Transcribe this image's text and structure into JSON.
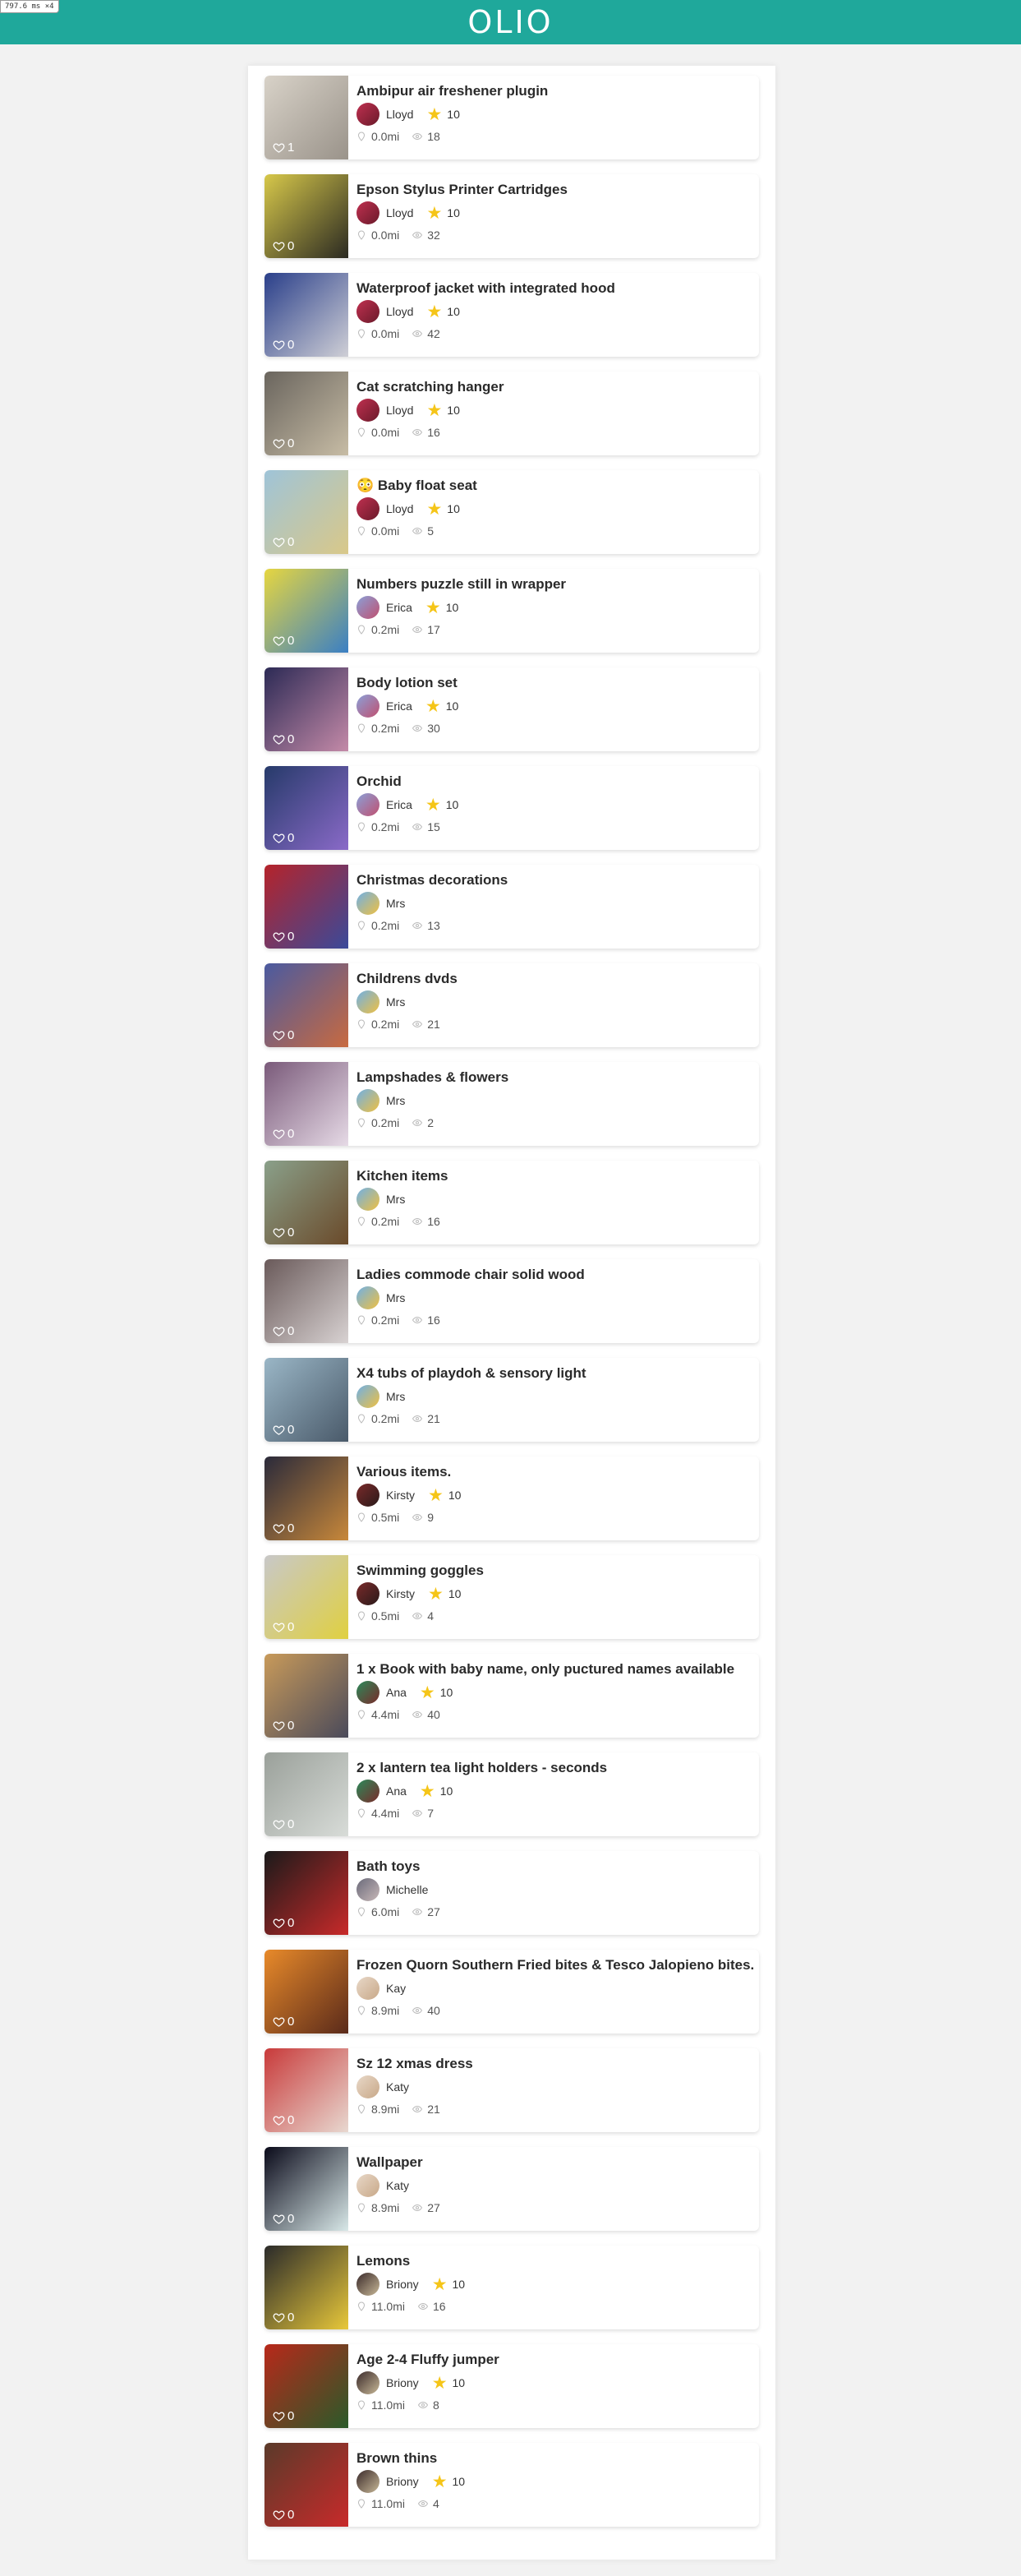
{
  "debug": "797.6 ms ×4",
  "app": {
    "logo": "OLIO"
  },
  "listings": [
    {
      "title": "Ambipur air freshener plugin",
      "user": "Lloyd",
      "rating": "10",
      "distance": "0.0mi",
      "views": "18",
      "likes": "1",
      "thumb": [
        "#d8d2c8",
        "#9a938a"
      ],
      "avatar": [
        "#c03050",
        "#6a1a2a"
      ]
    },
    {
      "title": "Epson Stylus Printer Cartridges",
      "user": "Lloyd",
      "rating": "10",
      "distance": "0.0mi",
      "views": "32",
      "likes": "0",
      "thumb": [
        "#d7c84a",
        "#2b2a22"
      ],
      "avatar": [
        "#c03050",
        "#6a1a2a"
      ]
    },
    {
      "title": "Waterproof jacket with integrated hood",
      "user": "Lloyd",
      "rating": "10",
      "distance": "0.0mi",
      "views": "42",
      "likes": "0",
      "thumb": [
        "#2a3f8a",
        "#cfcfd6"
      ],
      "avatar": [
        "#c03050",
        "#6a1a2a"
      ]
    },
    {
      "title": "Cat scratching hanger",
      "user": "Lloyd",
      "rating": "10",
      "distance": "0.0mi",
      "views": "16",
      "likes": "0",
      "thumb": [
        "#6a655e",
        "#c7bca5"
      ],
      "avatar": [
        "#c03050",
        "#6a1a2a"
      ]
    },
    {
      "title": "😳 Baby float seat",
      "user": "Lloyd",
      "rating": "10",
      "distance": "0.0mi",
      "views": "5",
      "likes": "0",
      "thumb": [
        "#9fc4d8",
        "#d9c889"
      ],
      "avatar": [
        "#c03050",
        "#6a1a2a"
      ]
    },
    {
      "title": "Numbers puzzle still in wrapper",
      "user": "Erica",
      "rating": "10",
      "distance": "0.2mi",
      "views": "17",
      "likes": "0",
      "thumb": [
        "#e6d640",
        "#3a7fc4"
      ],
      "avatar": [
        "#8aa0d8",
        "#c05070"
      ]
    },
    {
      "title": "Body lotion set",
      "user": "Erica",
      "rating": "10",
      "distance": "0.2mi",
      "views": "30",
      "likes": "0",
      "thumb": [
        "#2c2a55",
        "#c48aa8"
      ],
      "avatar": [
        "#8aa0d8",
        "#c05070"
      ]
    },
    {
      "title": "Orchid",
      "user": "Erica",
      "rating": "10",
      "distance": "0.2mi",
      "views": "15",
      "likes": "0",
      "thumb": [
        "#263a6a",
        "#8a6ac8"
      ],
      "avatar": [
        "#8aa0d8",
        "#c05070"
      ]
    },
    {
      "title": "Christmas decorations",
      "user": "Mrs",
      "rating": "",
      "distance": "0.2mi",
      "views": "13",
      "likes": "0",
      "thumb": [
        "#b5232a",
        "#3a4a9a"
      ],
      "avatar": [
        "#6fb0e6",
        "#f0c040"
      ]
    },
    {
      "title": "Childrens dvds",
      "user": "Mrs",
      "rating": "",
      "distance": "0.2mi",
      "views": "21",
      "likes": "0",
      "thumb": [
        "#4a5aa0",
        "#c86a40"
      ],
      "avatar": [
        "#6fb0e6",
        "#f0c040"
      ]
    },
    {
      "title": "Lampshades & flowers",
      "user": "Mrs",
      "rating": "",
      "distance": "0.2mi",
      "views": "2",
      "likes": "0",
      "thumb": [
        "#7a5a7a",
        "#e6dae6"
      ],
      "avatar": [
        "#6fb0e6",
        "#f0c040"
      ]
    },
    {
      "title": "Kitchen items",
      "user": "Mrs",
      "rating": "",
      "distance": "0.2mi",
      "views": "16",
      "likes": "0",
      "thumb": [
        "#8aa08a",
        "#6a4a2a"
      ],
      "avatar": [
        "#6fb0e6",
        "#f0c040"
      ]
    },
    {
      "title": "Ladies commode chair solid wood",
      "user": "Mrs",
      "rating": "",
      "distance": "0.2mi",
      "views": "16",
      "likes": "0",
      "thumb": [
        "#6a5a5a",
        "#d8d2d2"
      ],
      "avatar": [
        "#6fb0e6",
        "#f0c040"
      ]
    },
    {
      "title": "X4 tubs of playdoh & sensory light",
      "user": "Mrs",
      "rating": "",
      "distance": "0.2mi",
      "views": "21",
      "likes": "0",
      "thumb": [
        "#9ab6c6",
        "#4a5a6a"
      ],
      "avatar": [
        "#6fb0e6",
        "#f0c040"
      ]
    },
    {
      "title": "Various items.",
      "user": "Kirsty",
      "rating": "10",
      "distance": "0.5mi",
      "views": "9",
      "likes": "0",
      "thumb": [
        "#2a2a3a",
        "#c8883a"
      ],
      "avatar": [
        "#7a2a2a",
        "#2a1a1a"
      ]
    },
    {
      "title": "Swimming goggles",
      "user": "Kirsty",
      "rating": "10",
      "distance": "0.5mi",
      "views": "4",
      "likes": "0",
      "thumb": [
        "#c8c8c8",
        "#e0d040"
      ],
      "avatar": [
        "#7a2a2a",
        "#2a1a1a"
      ]
    },
    {
      "title": "1 x Book with baby name, only puctured names available",
      "user": "Ana",
      "rating": "10",
      "distance": "4.4mi",
      "views": "40",
      "likes": "0",
      "thumb": [
        "#c89a5a",
        "#4a4a5a"
      ],
      "avatar": [
        "#2a8a5a",
        "#7a2a2a"
      ]
    },
    {
      "title": "2 x lantern tea light holders - seconds",
      "user": "Ana",
      "rating": "10",
      "distance": "4.4mi",
      "views": "7",
      "likes": "0",
      "thumb": [
        "#9aa09a",
        "#d8dcd8"
      ],
      "avatar": [
        "#2a8a5a",
        "#7a2a2a"
      ]
    },
    {
      "title": "Bath toys",
      "user": "Michelle",
      "rating": "",
      "distance": "6.0mi",
      "views": "27",
      "likes": "0",
      "thumb": [
        "#1a1a1a",
        "#c82a2a"
      ],
      "avatar": [
        "#6a6a7a",
        "#c8b8b8"
      ]
    },
    {
      "title": "Frozen Quorn Southern Fried bites & Tesco Jalopieno bites.",
      "user": "Kay",
      "rating": "",
      "distance": "8.9mi",
      "views": "40",
      "likes": "0",
      "thumb": [
        "#e88a2a",
        "#5a2a1a"
      ],
      "avatar": [
        "#e8d8c8",
        "#c8a888"
      ]
    },
    {
      "title": "Sz 12 xmas dress",
      "user": "Katy",
      "rating": "",
      "distance": "8.9mi",
      "views": "21",
      "likes": "0",
      "thumb": [
        "#c83a3a",
        "#e8d8d0"
      ],
      "avatar": [
        "#e8d8c8",
        "#c8a888"
      ]
    },
    {
      "title": "Wallpaper",
      "user": "Katy",
      "rating": "",
      "distance": "8.9mi",
      "views": "27",
      "likes": "0",
      "thumb": [
        "#0a0a1a",
        "#d8e8e8"
      ],
      "avatar": [
        "#e8d8c8",
        "#c8a888"
      ]
    },
    {
      "title": "Lemons",
      "user": "Briony",
      "rating": "10",
      "distance": "11.0mi",
      "views": "16",
      "likes": "0",
      "thumb": [
        "#2a2a2a",
        "#e8c83a"
      ],
      "avatar": [
        "#3a2a2a",
        "#c8b898"
      ]
    },
    {
      "title": "Age 2-4 Fluffy jumper",
      "user": "Briony",
      "rating": "10",
      "distance": "11.0mi",
      "views": "8",
      "likes": "0",
      "thumb": [
        "#b8281a",
        "#2a5a2a"
      ],
      "avatar": [
        "#3a2a2a",
        "#c8b898"
      ]
    },
    {
      "title": "Brown thins",
      "user": "Briony",
      "rating": "10",
      "distance": "11.0mi",
      "views": "4",
      "likes": "0",
      "thumb": [
        "#5a3a2a",
        "#c82a2a"
      ],
      "avatar": [
        "#3a2a2a",
        "#c8b898"
      ]
    }
  ]
}
